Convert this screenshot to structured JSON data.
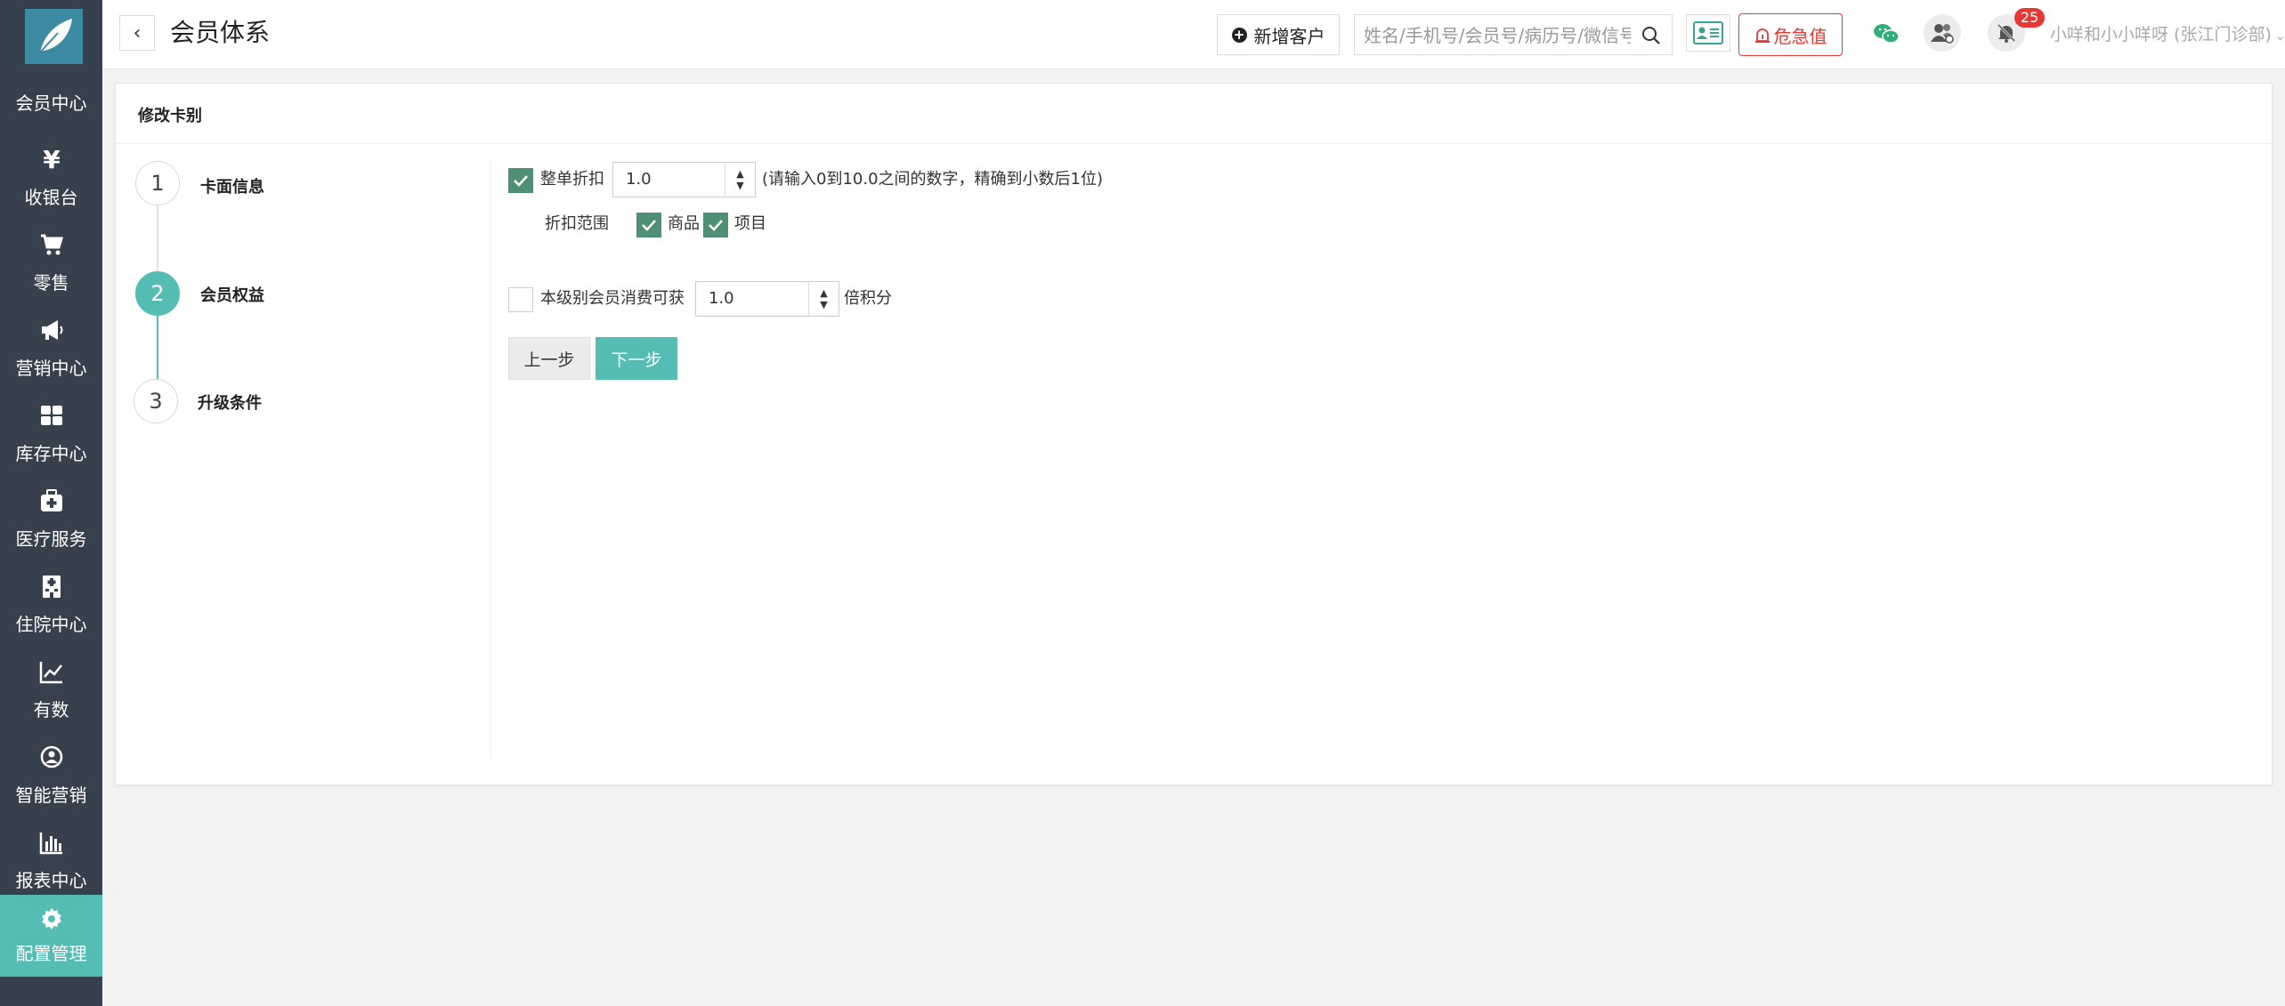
{
  "sidebar": {
    "items": [
      {
        "label": "会员中心",
        "icon": "member-icon"
      },
      {
        "label": "收银台",
        "icon": "yen-icon"
      },
      {
        "label": "零售",
        "icon": "cart-icon"
      },
      {
        "label": "营销中心",
        "icon": "megaphone-icon"
      },
      {
        "label": "库存中心",
        "icon": "grid-icon"
      },
      {
        "label": "医疗服务",
        "icon": "medkit-icon"
      },
      {
        "label": "住院中心",
        "icon": "hospital-icon"
      },
      {
        "label": "有数",
        "icon": "line-chart-icon"
      },
      {
        "label": "智能营销",
        "icon": "smart-marketing-icon"
      },
      {
        "label": "报表中心",
        "icon": "bar-chart-icon"
      },
      {
        "label": "配置管理",
        "icon": "gear-icon"
      }
    ],
    "active_index": 10
  },
  "header": {
    "back_symbol": "‹",
    "title": "会员体系",
    "add_customer_label": "新增客户",
    "search_placeholder": "姓名/手机号/会员号/病历号/微信号",
    "danger_label": "危急值",
    "notification_count": "25",
    "user_name": "小咩和小小咩呀 (张江门诊部)"
  },
  "panel": {
    "title": "修改卡别",
    "steps": [
      {
        "number": "1",
        "label": "卡面信息",
        "state": "done"
      },
      {
        "number": "2",
        "label": "会员权益",
        "state": "active"
      },
      {
        "number": "3",
        "label": "升级条件",
        "state": "pending"
      }
    ],
    "form": {
      "discount_label": "整单折扣",
      "discount_checked": true,
      "discount_value": "1.0",
      "discount_hint": "(请输入0到10.0之间的数字，精确到小数后1位)",
      "scope_label": "折扣范围",
      "scope_goods_label": "商品",
      "scope_goods_checked": true,
      "scope_items_label": "项目",
      "scope_items_checked": true,
      "points_label": "本级别会员消费可获",
      "points_checked": false,
      "points_value": "1.0",
      "points_suffix": "倍积分",
      "prev_label": "上一步",
      "next_label": "下一步"
    }
  },
  "colors": {
    "sidebar_bg": "#36414d",
    "accent": "#56bdb4",
    "checkbox_on": "#4f8f76",
    "danger": "#e53935"
  }
}
